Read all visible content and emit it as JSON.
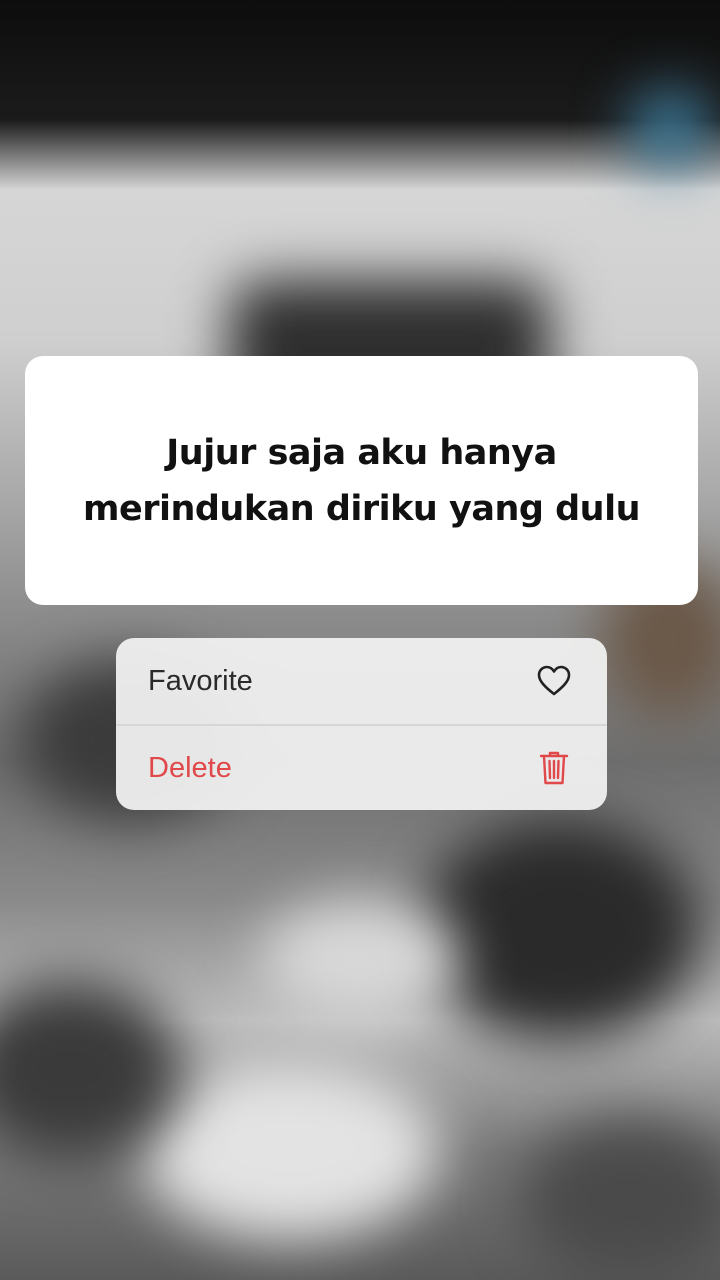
{
  "quote": {
    "line1": "Jujur saja aku hanya",
    "line2": "merindukan diriku yang dulu"
  },
  "menu": {
    "favorite_label": "Favorite",
    "favorite_icon": "heart-icon",
    "delete_label": "Delete",
    "delete_icon": "trash-icon",
    "delete_color": "#e0484a"
  }
}
